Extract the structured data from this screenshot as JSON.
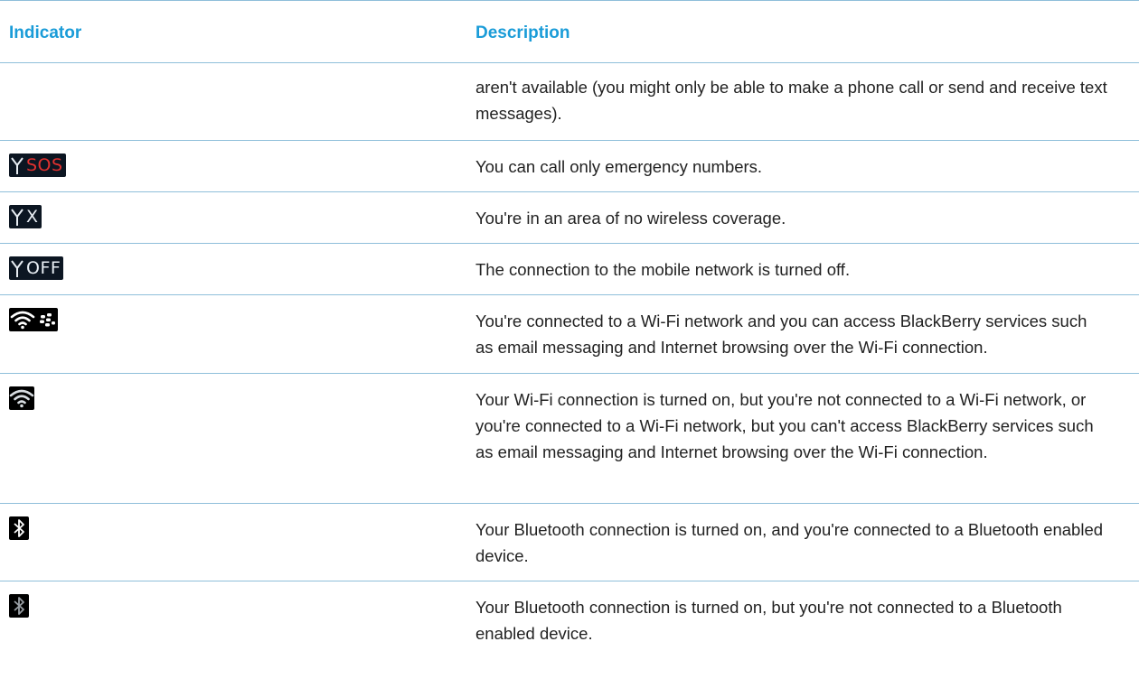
{
  "headers": {
    "indicator": "Indicator",
    "description": "Description"
  },
  "rows": [
    {
      "icon": "",
      "description": "aren't available (you might only be able to make a phone call or send and receive text messages)."
    },
    {
      "icon": "antenna-sos-icon",
      "icon_text": "SOS",
      "description": "You can call only emergency numbers."
    },
    {
      "icon": "antenna-no-coverage-icon",
      "icon_text": "X",
      "description": "You're in an area of no wireless coverage."
    },
    {
      "icon": "antenna-off-icon",
      "icon_text": "OFF",
      "description": "The connection to the mobile network is turned off."
    },
    {
      "icon": "wifi-blackberry-icon",
      "description": "You're connected to a Wi-Fi network and you can access BlackBerry services such as email messaging and Internet browsing over the Wi-Fi connection."
    },
    {
      "icon": "wifi-icon",
      "description": "Your Wi-Fi connection is turned on, but you're not connected to a Wi-Fi network, or you're connected to a Wi-Fi network, but you can't access BlackBerry services such as email messaging and Internet browsing over the Wi-Fi connection."
    },
    {
      "icon": "bluetooth-connected-icon",
      "description": "Your Bluetooth connection is turned on, and you're connected to a Bluetooth enabled device."
    },
    {
      "icon": "bluetooth-on-icon",
      "description": "Your Bluetooth connection is turned on, but you're not connected to a Bluetooth enabled device."
    }
  ],
  "colors": {
    "header_text": "#1a9cd8",
    "divider": "#8fbfda",
    "sos_text": "#e0312f",
    "icon_background": "#0c1622"
  }
}
